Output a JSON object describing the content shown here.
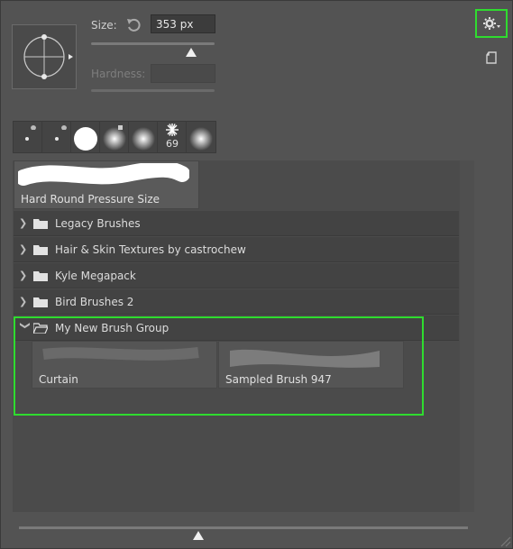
{
  "size": {
    "label": "Size:",
    "value": "353 px",
    "slider_fraction": 0.81
  },
  "hardness": {
    "label": "Hardness:",
    "value": ""
  },
  "recent_brushes": [
    {
      "icon": "small-soft-dot-icon",
      "badge": ""
    },
    {
      "icon": "small-dot-icon",
      "badge": ""
    },
    {
      "icon": "hard-round-icon",
      "badge": ""
    },
    {
      "icon": "soft-round-icon",
      "badge": ""
    },
    {
      "icon": "soft-round-icon",
      "badge": ""
    },
    {
      "icon": "starburst-icon",
      "badge": "69"
    },
    {
      "icon": "soft-round-icon",
      "badge": ""
    }
  ],
  "selected_brush": {
    "name": "Hard Round Pressure Size"
  },
  "folders": [
    {
      "name": "Legacy Brushes",
      "expanded": false
    },
    {
      "name": "Hair & Skin Textures by castrochew",
      "expanded": false
    },
    {
      "name": "Kyle Megapack",
      "expanded": false
    },
    {
      "name": "Bird Brushes 2",
      "expanded": false
    },
    {
      "name": "My New Brush Group",
      "expanded": true
    }
  ],
  "group_brushes": [
    {
      "name": "Curtain"
    },
    {
      "name": "Sampled Brush 947"
    }
  ],
  "preview_size_fraction": 0.4,
  "colors": {
    "highlight": "#2fdc2f",
    "panel_bg": "#535353"
  }
}
